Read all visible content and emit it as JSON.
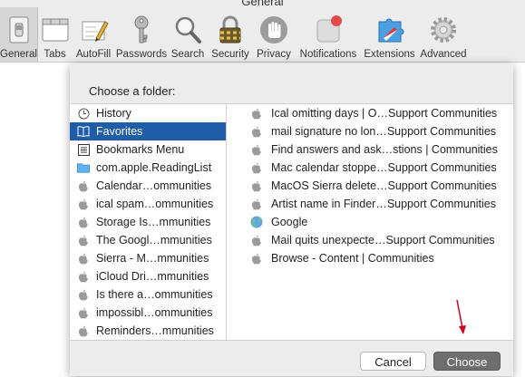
{
  "window": {
    "title": "General"
  },
  "toolbar": {
    "items": [
      {
        "label": "General",
        "icon": "switch-icon",
        "selected": true
      },
      {
        "label": "Tabs",
        "icon": "tabs-icon"
      },
      {
        "label": "AutoFill",
        "icon": "pencil-form-icon"
      },
      {
        "label": "Passwords",
        "icon": "key-icon"
      },
      {
        "label": "Search",
        "icon": "magnifier-icon"
      },
      {
        "label": "Security",
        "icon": "padlock-icon"
      },
      {
        "label": "Privacy",
        "icon": "hand-icon"
      },
      {
        "label": "Notifications",
        "icon": "notification-badge-icon"
      },
      {
        "label": "Extensions",
        "icon": "puzzle-compass-icon"
      },
      {
        "label": "Advanced",
        "icon": "gear-icon"
      }
    ]
  },
  "dialog": {
    "title": "Choose a folder:",
    "sidebar": [
      {
        "label": "History",
        "icon": "clock-icon"
      },
      {
        "label": "Favorites",
        "icon": "book-icon",
        "selected": true
      },
      {
        "label": "Bookmarks Menu",
        "icon": "menu-list-icon"
      },
      {
        "label": "com.apple.ReadingList",
        "icon": "folder-icon"
      },
      {
        "label": "Calendar…ommunities",
        "icon": "apple-icon"
      },
      {
        "label": "ical spam…ommunities",
        "icon": "apple-icon"
      },
      {
        "label": "Storage Is…mmunities",
        "icon": "apple-icon"
      },
      {
        "label": "The Googl…mmunities",
        "icon": "apple-icon"
      },
      {
        "label": "Sierra - M…mmunities",
        "icon": "apple-icon"
      },
      {
        "label": "iCloud Dri…mmunities",
        "icon": "apple-icon"
      },
      {
        "label": "Is there a…ommunities",
        "icon": "apple-icon"
      },
      {
        "label": "impossibl…ommunities",
        "icon": "apple-icon"
      },
      {
        "label": "Reminders…mmunities",
        "icon": "apple-icon"
      }
    ],
    "content": [
      {
        "label": "Ical omitting days | O…Support Communities",
        "icon": "apple-icon"
      },
      {
        "label": "mail signature no lon…Support Communities",
        "icon": "apple-icon"
      },
      {
        "label": "Find answers and ask…stions | Communities",
        "icon": "apple-icon"
      },
      {
        "label": "Mac calendar stoppe…Support Communities",
        "icon": "apple-icon"
      },
      {
        "label": "MacOS Sierra delete…Support Communities",
        "icon": "apple-icon"
      },
      {
        "label": "Artist name in Finder…Support Communities",
        "icon": "apple-icon"
      },
      {
        "label": "Google",
        "icon": "globe-icon"
      },
      {
        "label": "Mail quits unexpecte…Support Communities",
        "icon": "apple-icon"
      },
      {
        "label": "Browse - Content | Communities",
        "icon": "apple-icon"
      }
    ],
    "buttons": {
      "cancel": "Cancel",
      "choose": "Choose"
    }
  },
  "colors": {
    "selection": "#1f5da8",
    "choose_button": "#6e6e6e",
    "arrow": "#d0021b"
  }
}
